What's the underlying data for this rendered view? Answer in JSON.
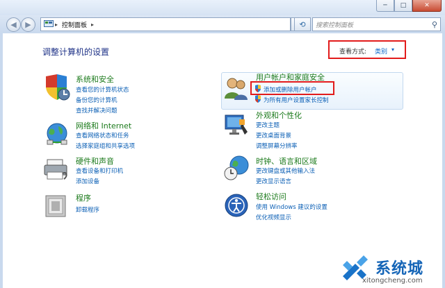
{
  "window": {
    "buttons": [
      "─",
      "□",
      "✕"
    ]
  },
  "nav": {
    "back_icon": "back-arrow-icon",
    "forward_icon": "forward-arrow-icon",
    "breadcrumb": [
      "控制面板"
    ],
    "search_placeholder": "搜索控制面板"
  },
  "header": {
    "title": "调整计算机的设置",
    "view_label": "查看方式:",
    "view_value": "类别",
    "caret": "▾"
  },
  "categories": [
    {
      "title": "系统和安全",
      "links": [
        "查看您的计算机状态",
        "备份您的计算机",
        "查找并解决问题"
      ]
    },
    {
      "title": "网络和 Internet",
      "links": [
        "查看网络状态和任务",
        "选择家庭组和共享选项"
      ]
    },
    {
      "title": "硬件和声音",
      "links": [
        "查看设备和打印机",
        "添加设备"
      ]
    },
    {
      "title": "程序",
      "links": [
        "卸载程序"
      ]
    },
    {
      "title": "用户帐户和家庭安全",
      "links": [
        "添加或删除用户帐户",
        "为所有用户设置家长控制"
      ]
    },
    {
      "title": "外观和个性化",
      "links": [
        "更改主题",
        "更改桌面背景",
        "调整屏幕分辨率"
      ]
    },
    {
      "title": "时钟、语言和区域",
      "links": [
        "更改键盘或其他输入法",
        "更改显示语言"
      ]
    },
    {
      "title": "轻松访问",
      "links": [
        "使用 Windows 建议的设置",
        "优化视频显示"
      ]
    }
  ],
  "watermark": {
    "text": "系统城",
    "sub": "xitongcheng.com"
  },
  "colors": {
    "highlight": "#e21b1b",
    "link": "#0b5fb5",
    "category_title": "#1b7a1b",
    "page_title": "#1e3287"
  }
}
